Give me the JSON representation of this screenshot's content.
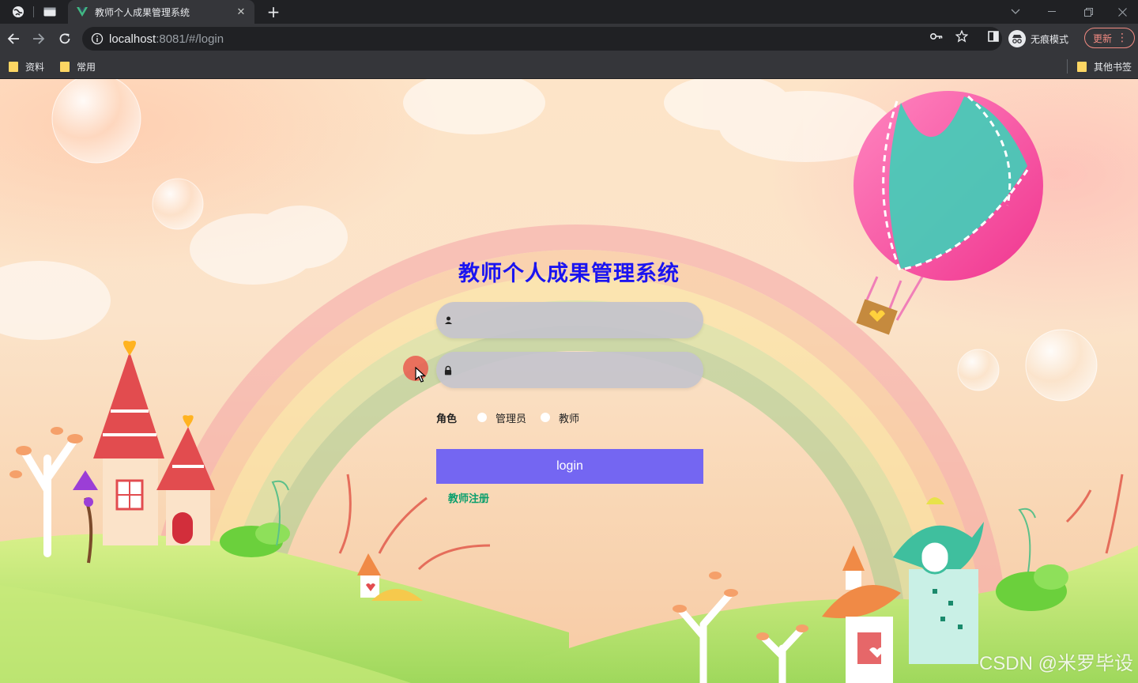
{
  "browser": {
    "tab": {
      "title": "教师个人成果管理系统"
    },
    "address": {
      "host": "localhost",
      "rest": ":8081/#/login"
    },
    "incognito_label": "无痕模式",
    "update_label": "更新",
    "bookmarks": [
      {
        "label": "资料"
      },
      {
        "label": "常用"
      }
    ],
    "other_bookmarks": "其他书签",
    "colors": {
      "frame": "#202124",
      "toolbar": "#35363a",
      "update": "#f28b82"
    }
  },
  "login": {
    "title": "教师个人成果管理系统",
    "username_placeholder": "",
    "password_placeholder": "",
    "role_label": "角色",
    "roles": [
      {
        "label": "管理员"
      },
      {
        "label": "教师"
      }
    ],
    "login_button": "login",
    "register_link": "教师注册",
    "colors": {
      "title": "#1b14f0",
      "button": "#7466f2",
      "link": "#0a9f6c"
    }
  },
  "watermark": "CSDN @米罗毕设"
}
